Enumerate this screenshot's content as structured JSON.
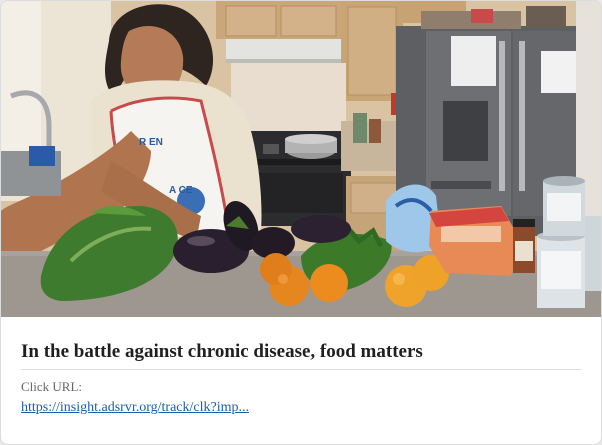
{
  "card": {
    "headline": "In the battle against chronic disease, food matters",
    "click_url_label": "Click URL:",
    "click_url": "https://insight.adsrvr.org/track/clk?imp...",
    "image": {
      "apron_text_1": "R EN",
      "apron_text_2": "A CE"
    }
  },
  "colors": {
    "link": "#1a5fa8",
    "headline": "#1f1f1f",
    "label": "#666666"
  }
}
